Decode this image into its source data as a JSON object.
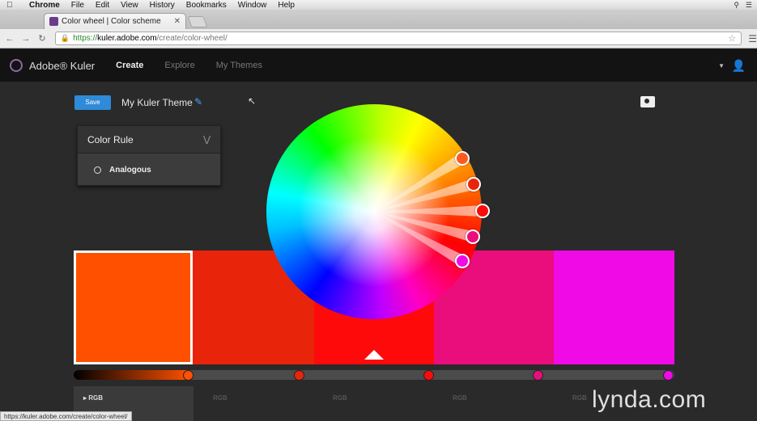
{
  "menubar": {
    "items": [
      "Chrome",
      "File",
      "Edit",
      "View",
      "History",
      "Bookmarks",
      "Window",
      "Help"
    ]
  },
  "browser": {
    "tab_title": "Color wheel | Color scheme",
    "url_protocol": "https://",
    "url_host": "kuler.adobe.com",
    "url_path": "/create/color-wheel/",
    "status_url": "https://kuler.adobe.com/create/color-wheel/"
  },
  "kuler": {
    "brand": "Adobe® Kuler",
    "nav": [
      {
        "label": "Create",
        "active": true
      },
      {
        "label": "Explore",
        "active": false
      },
      {
        "label": "My Themes",
        "active": false
      }
    ]
  },
  "theme": {
    "save_label": "Save",
    "name": "My Kuler Theme"
  },
  "color_rule": {
    "title": "Color Rule",
    "selected": "Analogous"
  },
  "swatches": [
    {
      "color": "#ff5000",
      "selected": true
    },
    {
      "color": "#e8250a",
      "selected": false
    },
    {
      "color": "#ff0a0a",
      "selected": false
    },
    {
      "color": "#ea0d7c",
      "selected": false
    },
    {
      "color": "#f00ae6",
      "selected": false
    }
  ],
  "handles": [
    {
      "color": "#ff5a1e"
    },
    {
      "color": "#e8250a"
    },
    {
      "color": "#ff0a0a"
    },
    {
      "color": "#ea0d7c"
    },
    {
      "color": "#f00ae6"
    }
  ],
  "rgb_label": "RGB",
  "watermark": "lynda.com"
}
